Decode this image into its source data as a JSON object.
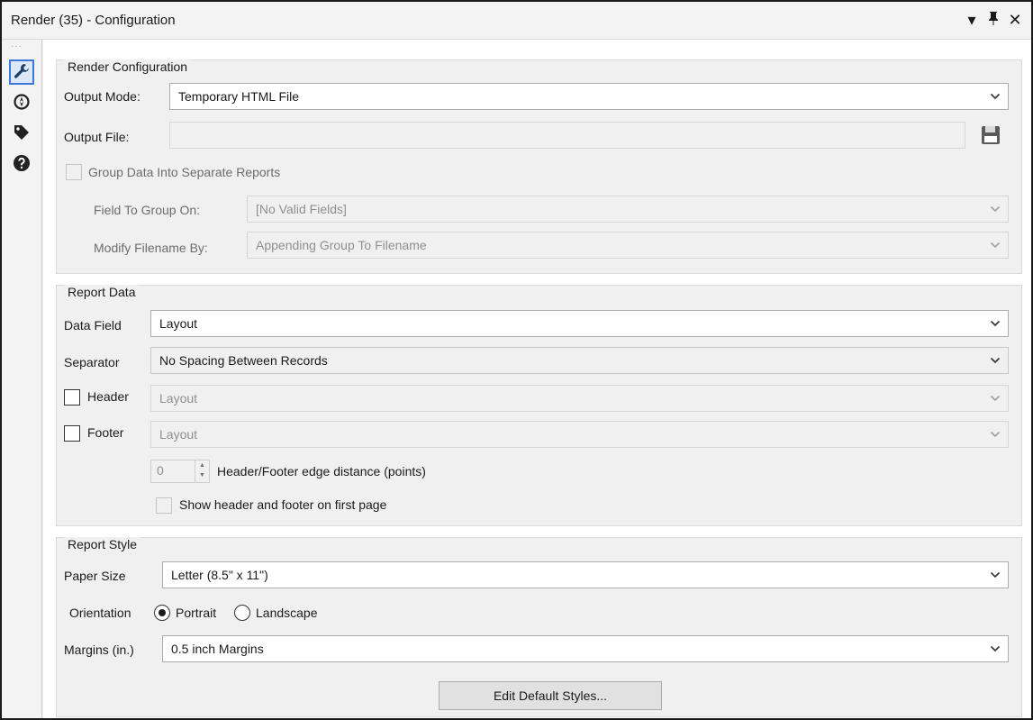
{
  "window": {
    "title": "Render (35) - Configuration",
    "controls": {
      "dropdown": "▾",
      "pin": "⊥",
      "close": "✕"
    }
  },
  "sidebar": {
    "items": [
      {
        "icon": "wrench-icon",
        "active": true
      },
      {
        "icon": "compass-icon",
        "active": false
      },
      {
        "icon": "tag-icon",
        "active": false
      },
      {
        "icon": "help-icon",
        "active": false
      }
    ]
  },
  "render_configuration": {
    "legend": "Render Configuration",
    "output_mode_label": "Output Mode:",
    "output_mode_value": "Temporary HTML File",
    "output_file_label": "Output File:",
    "output_file_value": "",
    "group_checkbox_label": "Group Data Into Separate Reports",
    "group_checked": false,
    "field_to_group_label": "Field To Group On:",
    "field_to_group_value": "[No Valid Fields]",
    "modify_filename_label": "Modify Filename By:",
    "modify_filename_value": "Appending Group To Filename"
  },
  "report_data": {
    "legend": "Report Data",
    "data_field_label": "Data Field",
    "data_field_value": "Layout",
    "separator_label": "Separator",
    "separator_value": "No Spacing Between Records",
    "header_label": "Header",
    "header_checked": false,
    "header_value": "Layout",
    "footer_label": "Footer",
    "footer_checked": false,
    "footer_value": "Layout",
    "edge_distance_value": "0",
    "edge_distance_label": "Header/Footer edge distance (points)",
    "show_first_page_label": "Show header and footer on first page",
    "show_first_page_checked": false
  },
  "report_style": {
    "legend": "Report Style",
    "paper_size_label": "Paper Size",
    "paper_size_value": "Letter (8.5\" x 11\")",
    "orientation_label": "Orientation",
    "portrait_label": "Portrait",
    "landscape_label": "Landscape",
    "orientation_selected": "Portrait",
    "margins_label": "Margins (in.)",
    "margins_value": "0.5 inch Margins",
    "edit_styles_button": "Edit Default Styles..."
  }
}
